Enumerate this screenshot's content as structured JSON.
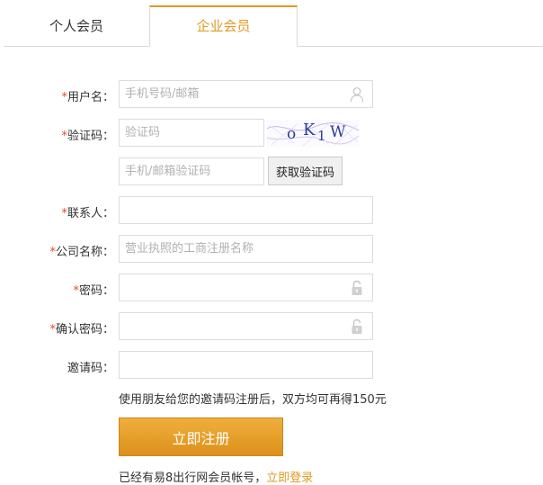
{
  "tabs": {
    "personal": "个人会员",
    "enterprise": "企业会员"
  },
  "form": {
    "required_mark": "*",
    "username": {
      "label": "用户名：",
      "placeholder": "手机号码/邮箱",
      "value": ""
    },
    "captcha": {
      "label": "验证码：",
      "placeholder": "验证码",
      "value": "",
      "image_text": "oK1W"
    },
    "sms_code": {
      "placeholder": "手机/邮箱验证码",
      "value": "",
      "button": "获取验证码"
    },
    "contact": {
      "label": "联系人：",
      "placeholder": "",
      "value": ""
    },
    "company": {
      "label": "公司名称：",
      "placeholder": "营业执照的工商注册名称",
      "value": ""
    },
    "password": {
      "label": "密码：",
      "placeholder": "",
      "value": ""
    },
    "confirm_password": {
      "label": "确认密码：",
      "placeholder": "",
      "value": ""
    },
    "invite_code": {
      "label": "邀请码：",
      "placeholder": "",
      "value": ""
    }
  },
  "promo_text": "使用朋友给您的邀请码注册后，双方均可再得150元",
  "submit_label": "立即注册",
  "login": {
    "prefix": "已经有易8出行网会员帐号，",
    "link": "立即登录"
  },
  "icons": {
    "user_field": "user-icon",
    "password_field": "lock-icon",
    "confirm_field": "lock-icon"
  },
  "colors": {
    "accent": "#e09a25",
    "required": "#e24b24",
    "border": "#dcdcdc"
  }
}
